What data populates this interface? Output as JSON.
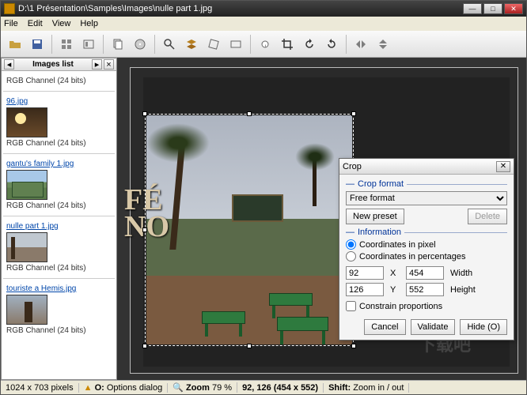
{
  "titlebar": {
    "title": "D:\\1 Présentation\\Samples\\Images\\nulle part 1.jpg"
  },
  "menu": {
    "file": "File",
    "edit": "Edit",
    "view": "View",
    "help": "Help"
  },
  "sidebar": {
    "header": "Images list",
    "channel_label": "RGB Channel (24 bits)",
    "items": [
      {
        "name": "96.jpg"
      },
      {
        "name": "gantu's family 1.jpg"
      },
      {
        "name": "nulle part 1.jpg"
      },
      {
        "name": "touriste a Hemis.jpg"
      }
    ]
  },
  "dialog": {
    "title": "Crop",
    "crop_format": "Crop format",
    "format_value": "Free format",
    "new_preset": "New preset",
    "delete": "Delete",
    "information": "Information",
    "coord_px": "Coordinates in pixel",
    "coord_pct": "Coordinates in percentages",
    "x": "92",
    "y": "126",
    "w": "454",
    "h": "552",
    "xlbl": "X",
    "ylbl": "Y",
    "wlbl": "Width",
    "hlbl": "Height",
    "constrain": "Constrain proportions",
    "cancel": "Cancel",
    "validate": "Validate",
    "hide": "Hide (O)"
  },
  "status": {
    "dims": "1024 x 703 pixels",
    "opt_key": "O:",
    "opt_val": "Options dialog",
    "zoom_key": "Zoom",
    "zoom_val": "79 %",
    "info": "92, 126 (454 x 552)",
    "shift_key": "Shift:",
    "shift_val": "Zoom in / out"
  }
}
